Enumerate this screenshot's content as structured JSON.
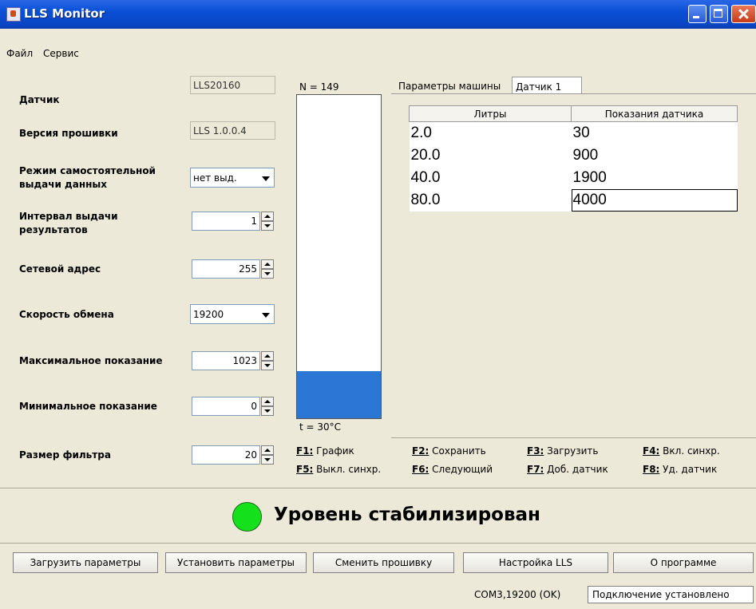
{
  "window": {
    "title": "LLS Monitor"
  },
  "menu": [
    "Файл",
    "Сервис"
  ],
  "params": {
    "sensor_label": "Датчик",
    "sensor_value": "LLS20160",
    "firmware_label": "Версия прошивки",
    "firmware_value": "LLS 1.0.0.4",
    "mode_label": "Режим самостоятельной выдачи данных",
    "mode_value": "нет выд.",
    "interval_label": "Интервал выдачи результатов",
    "interval_value": "1",
    "address_label": "Сетевой адрес",
    "address_value": "255",
    "speed_label": "Скорость обмена",
    "speed_value": "19200",
    "max_label": "Максимальное показание",
    "max_value": "1023",
    "min_label": "Минимальное показание",
    "min_value": "0",
    "filter_label": "Размер фильтра",
    "filter_value": "20"
  },
  "level": {
    "n_text": "N = 149",
    "temp_text": "t = 30°C",
    "fill_fraction": 0.146,
    "fill_color": "#2c76d6"
  },
  "tabs": [
    "Параметры машины",
    "Датчик 1"
  ],
  "calibration": {
    "headers": [
      "Литры",
      "Показания датчика"
    ],
    "rows": [
      [
        "2.0",
        "30"
      ],
      [
        "20.0",
        "900"
      ],
      [
        "40.0",
        "1900"
      ],
      [
        "80.0",
        "4000"
      ]
    ]
  },
  "hotkeys": [
    {
      "key": "F1:",
      "label": " График"
    },
    {
      "key": "F2:",
      "label": " Сохранить"
    },
    {
      "key": "F3:",
      "label": " Загрузить"
    },
    {
      "key": "F4:",
      "label": " Вкл. синхр."
    },
    {
      "key": "F5:",
      "label": " Выкл. синхр."
    },
    {
      "key": "F6:",
      "label": " Следующий"
    },
    {
      "key": "F7:",
      "label": " Доб. датчик"
    },
    {
      "key": "F8:",
      "label": " Уд. датчик"
    }
  ],
  "status": {
    "text": "Уровень стабилизирован",
    "indicator_color": "#14e01c"
  },
  "buttons": [
    "Загрузить параметры",
    "Установить параметры",
    "Сменить прошивку",
    "Настройка LLS",
    "О программе"
  ],
  "connection": {
    "port": "COM3,19200   (OK)",
    "state": "Подключение установлено"
  }
}
